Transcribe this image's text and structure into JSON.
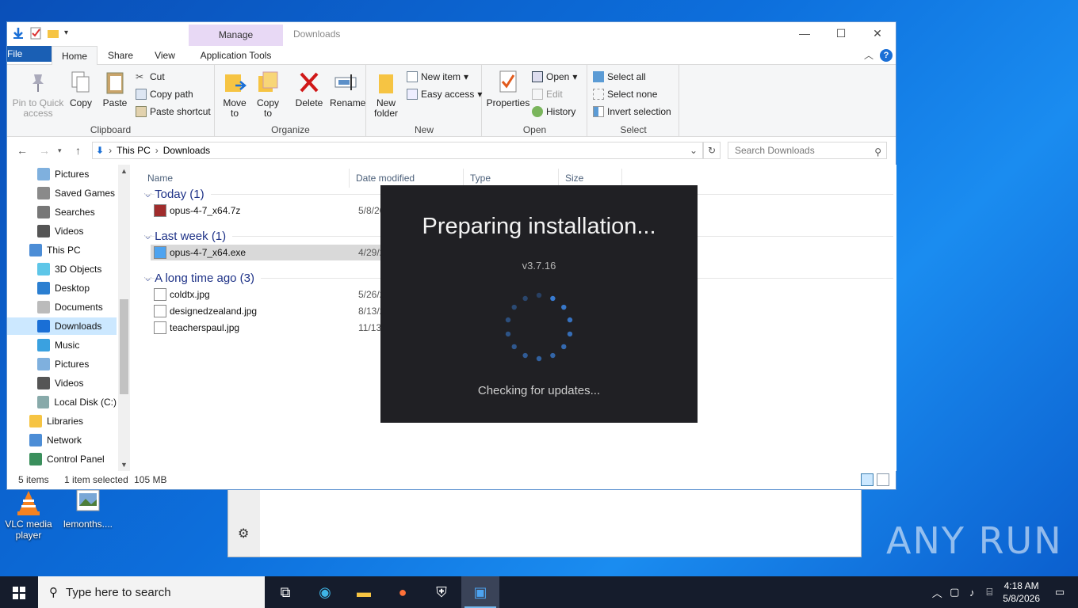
{
  "desktop": {
    "icons": [
      {
        "label": "VLC media player",
        "icon": "vlc-icon"
      },
      {
        "label": "lemonths....",
        "icon": "image-file-icon"
      }
    ],
    "watermark": "ANY RUN"
  },
  "explorer": {
    "title": "Downloads",
    "manage_tab": "Manage",
    "tabs": {
      "file": "File",
      "home": "Home",
      "share": "Share",
      "view": "View",
      "app_tools": "Application Tools"
    },
    "ribbon": {
      "clipboard": {
        "label": "Clipboard",
        "pin": "Pin to Quick access",
        "copy": "Copy",
        "paste": "Paste",
        "cut": "Cut",
        "copy_path": "Copy path",
        "paste_shortcut": "Paste shortcut"
      },
      "organize": {
        "label": "Organize",
        "move_to": "Move to",
        "copy_to": "Copy to",
        "delete": "Delete",
        "rename": "Rename"
      },
      "new": {
        "label": "New",
        "new_folder": "New folder",
        "new_item": "New item",
        "easy_access": "Easy access"
      },
      "open": {
        "label": "Open",
        "properties": "Properties",
        "open": "Open",
        "edit": "Edit",
        "history": "History"
      },
      "select": {
        "label": "Select",
        "select_all": "Select all",
        "select_none": "Select none",
        "invert": "Invert selection"
      }
    },
    "address": {
      "crumbs": [
        "This PC",
        "Downloads"
      ],
      "search_placeholder": "Search Downloads"
    },
    "nav": [
      {
        "label": "Pictures",
        "icon": "pictures-icon"
      },
      {
        "label": "Saved Games",
        "icon": "saved-games-icon"
      },
      {
        "label": "Searches",
        "icon": "search-icon"
      },
      {
        "label": "Videos",
        "icon": "videos-icon"
      },
      {
        "label": "This PC",
        "icon": "this-pc-icon"
      },
      {
        "label": "3D Objects",
        "icon": "3d-objects-icon"
      },
      {
        "label": "Desktop",
        "icon": "desktop-icon"
      },
      {
        "label": "Documents",
        "icon": "documents-icon"
      },
      {
        "label": "Downloads",
        "icon": "downloads-icon"
      },
      {
        "label": "Music",
        "icon": "music-icon"
      },
      {
        "label": "Pictures",
        "icon": "pictures-icon"
      },
      {
        "label": "Videos",
        "icon": "videos-icon"
      },
      {
        "label": "Local Disk (C:)",
        "icon": "local-disk-icon"
      },
      {
        "label": "Libraries",
        "icon": "libraries-icon"
      },
      {
        "label": "Network",
        "icon": "network-icon"
      },
      {
        "label": "Control Panel",
        "icon": "control-panel-icon"
      }
    ],
    "columns": {
      "name": "Name",
      "date": "Date modified",
      "type": "Type",
      "size": "Size"
    },
    "groups": [
      {
        "label": "Today (1)",
        "files": [
          {
            "name": "opus-4-7_x64.7z",
            "date": "5/8/20",
            "icon": "archive-icon"
          }
        ]
      },
      {
        "label": "Last week (1)",
        "files": [
          {
            "name": "opus-4-7_x64.exe",
            "date": "4/29/2",
            "icon": "installer-icon"
          }
        ]
      },
      {
        "label": "A long time ago (3)",
        "files": [
          {
            "name": "coldtx.jpg",
            "date": "5/26/2",
            "icon": "image-file-icon"
          },
          {
            "name": "designedzealand.jpg",
            "date": "8/13/2",
            "icon": "image-file-icon"
          },
          {
            "name": "teacherspaul.jpg",
            "date": "11/13/",
            "icon": "image-file-icon"
          }
        ]
      }
    ],
    "status": {
      "items": "5 items",
      "selected": "1 item selected",
      "size": "105 MB"
    }
  },
  "installer": {
    "title": "Preparing installation...",
    "version": "v3.7.16",
    "status": "Checking for updates...",
    "accent": "#3a7fd9"
  },
  "taskbar": {
    "search_placeholder": "Type here to search",
    "time": "4:18 AM",
    "date": "5/8/2026"
  }
}
